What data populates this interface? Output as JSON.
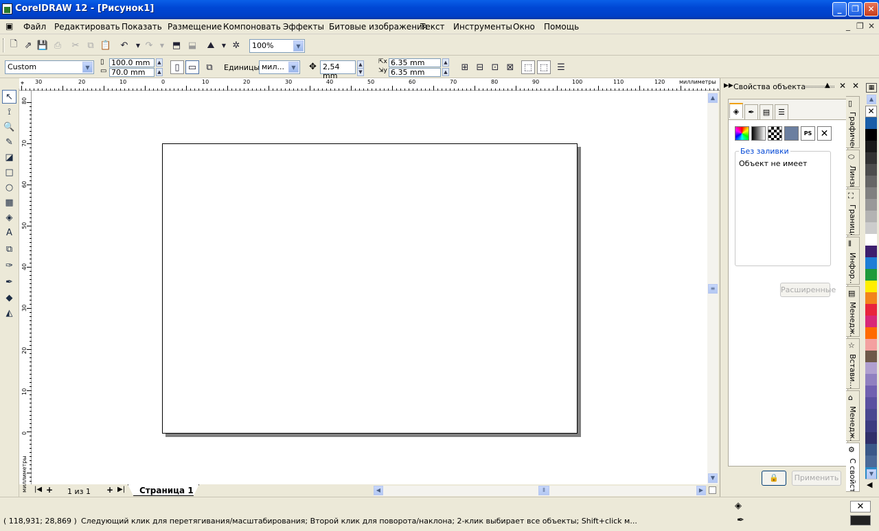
{
  "window": {
    "title": "CorelDRAW 12 - [Рисунок1]"
  },
  "menu": [
    "Файл",
    "Редактировать",
    "Показать",
    "Размещение",
    "Компоновать",
    "Эффекты",
    "Битовые изображения",
    "Текст",
    "Инструменты",
    "Окно",
    "Помощь"
  ],
  "standard_toolbar": {
    "zoom": "100%"
  },
  "property_bar": {
    "page_preset": "Custom",
    "width": "100.0 mm",
    "height": "70.0 mm",
    "units_label": "Единицы:",
    "units_value": "мил...",
    "nudge": "2,54 mm",
    "dup_x": "6.35 mm",
    "dup_y": "6.35 mm"
  },
  "rulers": {
    "unit_label": "миллиметры",
    "h_ticks": [
      "30",
      "20",
      "10",
      "0",
      "10",
      "20",
      "30",
      "40",
      "50",
      "60",
      "70",
      "80",
      "90",
      "100",
      "110",
      "120"
    ],
    "v_ticks": [
      "80",
      "70",
      "60",
      "50",
      "40",
      "30",
      "20",
      "10",
      "0"
    ],
    "v_unit_label": "миллиметры"
  },
  "page_nav": {
    "counter": "1 из 1",
    "tab": "Страница 1"
  },
  "status": {
    "coords": "( 118,931; 28,869 )",
    "hint": "Следующий клик для перетягивания/масштабирования; Второй клик для поворота/наклона; 2-клик выбирает все объекты; Shift+click м..."
  },
  "docker": {
    "title": "Свойства объекта",
    "group_label": "Без заливки",
    "group_text": "Объект не имеет",
    "advanced_button": "Расширенные",
    "apply_button": "Применить",
    "vertical_tabs": [
      "Графическ...",
      "Линзы",
      "Граница",
      "Инфор...",
      "Менедж...",
      "Встави...",
      "Менедж...",
      "С свойст..."
    ]
  },
  "palette_colors": [
    "#1a5ea8",
    "#000000",
    "#1a1a1a",
    "#333333",
    "#4d4d4d",
    "#666666",
    "#808080",
    "#999999",
    "#b3b3b3",
    "#cccccc",
    "#ffffff",
    "#3d1f6e",
    "#1e7fd6",
    "#1e9a3a",
    "#ffee00",
    "#f2841c",
    "#e8243c",
    "#d82878",
    "#ff6a00",
    "#f4a0a0",
    "#6e5a4a",
    "#b0a0d0",
    "#9080c0",
    "#7060b0",
    "#5a50a0",
    "#4a4890",
    "#3c3c80",
    "#30306a",
    "#3a5888",
    "#4a6a98",
    "#2a8ac8"
  ]
}
